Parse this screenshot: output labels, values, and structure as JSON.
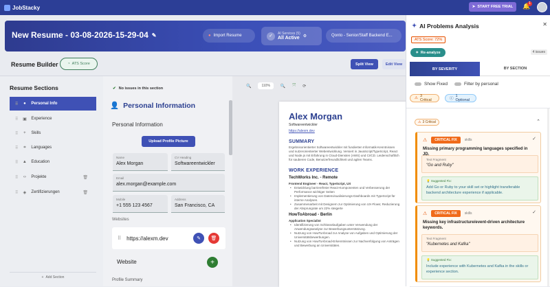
{
  "app": {
    "name": "JobStacky",
    "trial_button": "START FREE TRIAL",
    "notif_count": "1"
  },
  "banner": {
    "title": "New Resume - 03-08-2026-15-29-04",
    "import_label": "Import Resume",
    "ai_services_label": "AI Services (5)",
    "ai_services_status": "All Active",
    "job_label": "Qonto - Senior/Staff Backend E..."
  },
  "builder": {
    "title": "Resume Builder",
    "ats_label": "ATS Score",
    "split_view": "Split View",
    "edit_view": "Edit View"
  },
  "sections": {
    "title": "Resume Sections",
    "items": [
      {
        "label": "Personal Info",
        "icon": "person-icon"
      },
      {
        "label": "Experience",
        "icon": "briefcase-icon"
      },
      {
        "label": "Skills",
        "icon": "plus-icon"
      },
      {
        "label": "Languages",
        "icon": "translate-icon"
      },
      {
        "label": "Education",
        "icon": "cap-icon"
      },
      {
        "label": "Projekte",
        "icon": "code-icon"
      },
      {
        "label": "Zertifizierungen",
        "icon": "certificate-icon"
      }
    ],
    "add_section": "Add Section"
  },
  "editor": {
    "no_issues": "No issues in this section",
    "heading": "Personal Information",
    "sub": "Personal Information",
    "upload": "Upload Profile Picture",
    "fields": {
      "name_label": "Name",
      "name": "Alex Morgan",
      "cv_label": "CV Heading",
      "cv": "Softwareentwickler",
      "email_label": "Email",
      "email": "alex.morgan@example.com",
      "mobile_label": "Mobile",
      "mobile": "+1 555 123 4567",
      "address_label": "Address",
      "address": "San Francisco, CA"
    },
    "websites_label": "Websites",
    "website_url": "https://alexm.dev",
    "website_add_label": "Website",
    "profile_summary": "Profile Summary"
  },
  "preview": {
    "zoom": "110%",
    "name": "Alex Morgan",
    "title": "Softwareentwickler",
    "link": "https://alexm.dev",
    "summary_head": "SUMMARY",
    "summary": "Ergebnisorientierter Softwareentwickler mit fundierten Informatik-Kenntnissen und nutzerorientierter Webentwicklung. Versiert in JavaScript/TypeScript, React und Node.js mit Erfahrung in Cloud-Diensten (AWS) und CI/CD. Leidenschaftlich für sauberen Code, Benutzerfreundlichkeit und agilen Teams.",
    "exp_head": "WORK EXPERIENCE",
    "job1": "TechWorks Inc. - Remote",
    "job1_role": "Frontend Engineer - React, TypeScript, UX",
    "job1_bullets": [
      "Entwicklung barrierefreier React-Komponenten und Verbesserung der Performance wichtiger Seiten",
      "Implementierung von Datenvisualisierungs-Dashboards mit TypeScript für interne Analysen.",
      "Zusammenarbeit mit Designern zur Optimierung von UX-Flows; Reduzierung der Absprungrate um 22% steigerte"
    ],
    "job2": "HowToAbroad - Berlin",
    "job2_role": "Application Specialist",
    "job2_bullets": [
      "Identifizierung von Schlüsselaufgaben unter Verwendung der Anwendungsanalyse zur Bewerbungsunterstützung.",
      "Nutzung von HowToAbroad zur Analyse von Aufgaben und Optimierung der Universitätsbewerbungen.",
      "Nutzung von HowToAbroad-Erkenntnissen zur Nachverfolgung von Anträgen und Bewerbung an Universitäten."
    ]
  },
  "panel": {
    "title": "AI Problems Analysis",
    "ats_score": "ATS Score: 72%",
    "reanalyze": "Re-analyze",
    "issues_count": "4 issues",
    "tab_severity": "BY SEVERITY",
    "tab_section": "BY SECTION",
    "show_fixed": "Show Fixed",
    "filter_personal": "Filter by personal",
    "critical_chip": "3 Critical",
    "optional_chip": "1 Optional",
    "group_label": "3 Critical",
    "cards": [
      {
        "badge": "CRITICAL FIX",
        "category": "skills",
        "message": "Missing primary programming languages specified in JD.",
        "fragment_label": "Text Fragment",
        "fragment": "\"Go and Ruby\"",
        "fix_label": "Suggested Fix:",
        "fix": "Add Go or Ruby to your skill set or highlight transferable backend architecture experience if applicable."
      },
      {
        "badge": "CRITICAL FIX",
        "category": "skills",
        "message": "Missing key infrastructure/event-driven architecture keywords.",
        "fragment_label": "Text Fragment",
        "fragment": "\"Kubernetes and Kafka\"",
        "fix_label": "Suggested Fix:",
        "fix": "Include experience with Kubernetes and Kafka in the skills or experience section."
      }
    ]
  },
  "colors": {
    "primary": "#3f51b5",
    "critical": "#f06a1a",
    "teal": "#2a8f8b",
    "danger": "#e53935",
    "success": "#2e7d32"
  }
}
